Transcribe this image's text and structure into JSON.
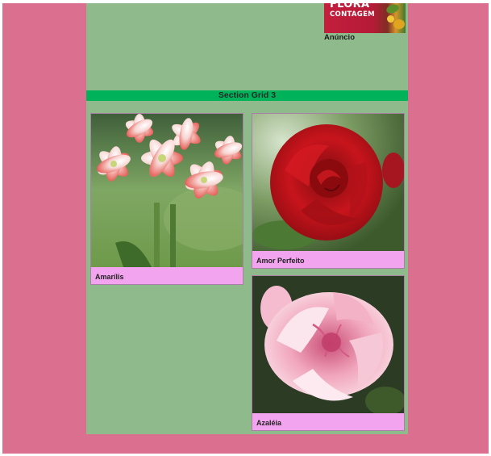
{
  "ad": {
    "brand_line1": "FLORA",
    "brand_line2": "CONTAGEM",
    "label": "Anúncio"
  },
  "section": {
    "title": "Section Grid 3"
  },
  "cards": [
    {
      "caption": "Amarílis",
      "icon": "amaryllis-flower-image"
    },
    {
      "caption": "Amor Perfeito",
      "icon": "red-rose-image"
    },
    {
      "caption": "Azaléia",
      "icon": "pink-azalea-image"
    }
  ],
  "colors": {
    "page_background": "#db6f8f",
    "content_background": "#8fbb8c",
    "section_bar": "#00b35a",
    "card_background": "#f3a4ee"
  }
}
